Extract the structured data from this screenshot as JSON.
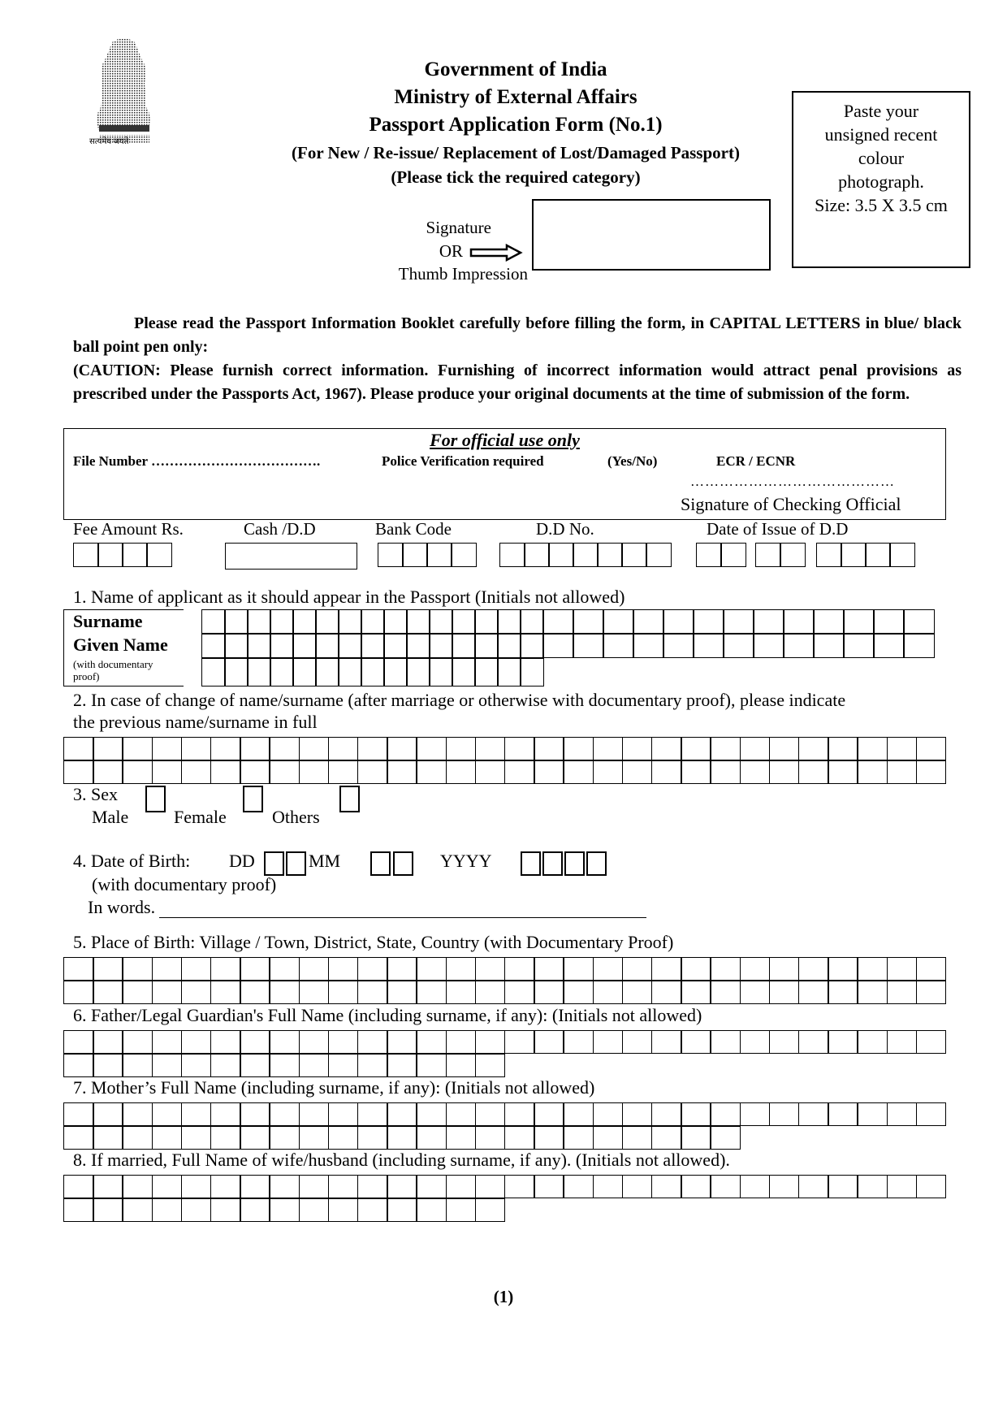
{
  "header": {
    "line1": "Government of India",
    "line2": "Ministry of External Affairs",
    "line3": "Passport Application Form (No.1)",
    "line4": "(For New / Re-issue/ Replacement of Lost/Damaged Passport)",
    "line5": "(Please tick the required category)",
    "emblem_motto": "सत्यमेव जयते"
  },
  "photo_box": {
    "lines": [
      "Paste your",
      "unsigned recent",
      "colour",
      "photograph.",
      "Size: 3.5 X 3.5 cm"
    ]
  },
  "signature": {
    "line1": "Signature",
    "line2": "OR",
    "line3": "Thumb Impression"
  },
  "instructions": {
    "para1": "Please read the Passport Information Booklet carefully before filling the form, in CAPITAL LETTERS in blue/ black ball point pen only:",
    "para2": "(CAUTION: Please furnish correct information. Furnishing of incorrect information would attract penal provisions as prescribed under the Passports Act, 1967). Please produce your original documents at the time of submission of the form."
  },
  "official_use": {
    "title": "For official use only",
    "file_number": "File Number ……………………………….",
    "police_verification": "Police Verification required",
    "yes_no": "(Yes/No)",
    "ecr": "ECR / ECNR",
    "dots": "……………………………………",
    "signature_label": "Signature of Checking Official"
  },
  "fees": {
    "fee_amount": "Fee Amount Rs.",
    "cash_dd": "Cash /D.D",
    "bank_code": "Bank Code",
    "dd_no": "D.D No.",
    "date_issue": "Date  of Issue of D.D",
    "box_counts": {
      "fee": 4,
      "bank": 4,
      "dd": 7,
      "date_dd": 2,
      "date_mm": 2,
      "date_yyyy": 4
    }
  },
  "q1": {
    "label": "1. Name of applicant as it should appear in the Passport (Initials not allowed)",
    "surname": "Surname",
    "given_name": "Given Name",
    "proof_note": "(with documentary proof)"
  },
  "q2": {
    "label_line1": "2. In case of change of name/surname (after marriage or otherwise with documentary proof), please indicate",
    "label_line2": "the previous name/surname in full"
  },
  "q3": {
    "label": "3. Sex",
    "male": "Male",
    "female": "Female",
    "others": "Others"
  },
  "q4": {
    "label": "4. Date of Birth:",
    "dd": "DD",
    "mm": "MM",
    "yyyy": "YYYY",
    "proof": "(with documentary proof)",
    "in_words": "In words."
  },
  "q5": {
    "label": "5. Place of Birth: Village / Town, District, State, Country (with Documentary Proof)"
  },
  "q6": {
    "label": "6. Father/Legal Guardian's Full Name (including surname, if any): (Initials not allowed)"
  },
  "q7": {
    "label": "7. Mother’s Full Name (including surname, if any): (Initials not allowed)"
  },
  "q8": {
    "label": "8. If married, Full Name of wife/husband (including surname, if any). (Initials not allowed)."
  },
  "footer": {
    "page_number": "(1)"
  }
}
